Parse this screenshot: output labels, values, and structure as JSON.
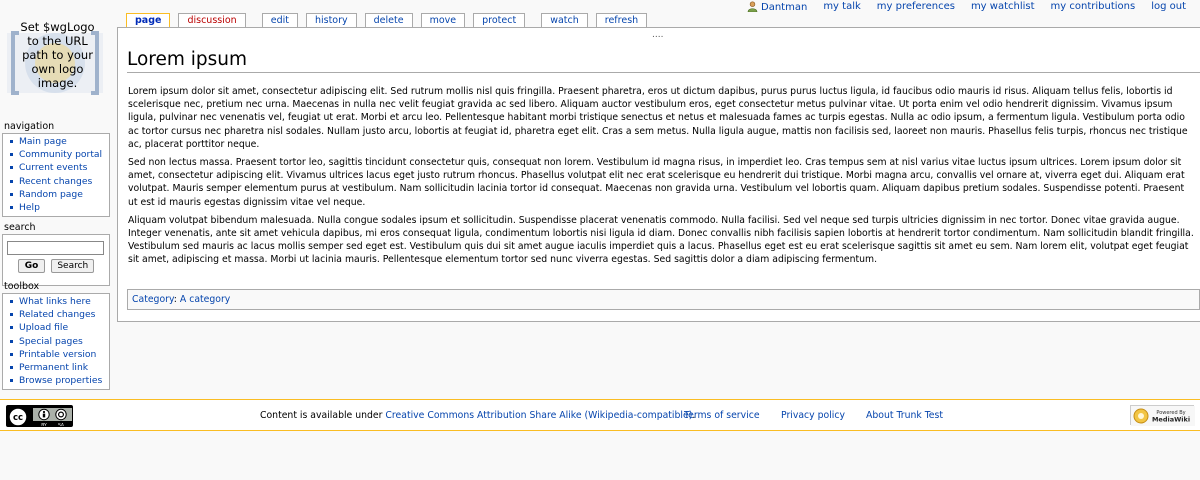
{
  "personal": {
    "username": "Dantman",
    "talk": "my talk",
    "preferences": "my preferences",
    "watchlist": "my watchlist",
    "contributions": "my contributions",
    "logout": "log out"
  },
  "logo": {
    "lines": [
      "Set $wgLogo",
      "to the URL",
      "path to your",
      "own logo",
      "image."
    ]
  },
  "tabs": {
    "page": "page",
    "discussion": "discussion",
    "edit": "edit",
    "history": "history",
    "delete": "delete",
    "move": "move",
    "protect": "protect",
    "watch": "watch",
    "refresh": "refresh"
  },
  "content": {
    "dots": "....",
    "title": "Lorem ipsum",
    "paragraphs": [
      "Lorem ipsum dolor sit amet, consectetur adipiscing elit. Sed rutrum mollis nisl quis fringilla. Praesent pharetra, eros ut dictum dapibus, purus purus luctus ligula, id faucibus odio mauris id risus. Aliquam tellus felis, lobortis id scelerisque nec, pretium nec urna. Maecenas in nulla nec velit feugiat gravida ac sed libero. Aliquam auctor vestibulum eros, eget consectetur metus pulvinar vitae. Ut porta enim vel odio hendrerit dignissim. Vivamus ipsum ligula, pulvinar nec venenatis vel, feugiat ut erat. Morbi et arcu leo. Pellentesque habitant morbi tristique senectus et netus et malesuada fames ac turpis egestas. Nulla ac odio ipsum, a fermentum ligula. Vestibulum porta odio ac tortor cursus nec pharetra nisl sodales. Nullam justo arcu, lobortis at feugiat id, pharetra eget elit. Cras a sem metus. Nulla ligula augue, mattis non facilisis sed, laoreet non mauris. Phasellus felis turpis, rhoncus nec tristique ac, placerat porttitor neque.",
      "Sed non lectus massa. Praesent tortor leo, sagittis tincidunt consectetur quis, consequat non lorem. Vestibulum id magna risus, in imperdiet leo. Cras tempus sem at nisl varius vitae luctus ipsum ultrices. Lorem ipsum dolor sit amet, consectetur adipiscing elit. Vivamus ultrices lacus eget justo rutrum rhoncus. Phasellus volutpat elit nec erat scelerisque eu hendrerit dui tristique. Morbi magna arcu, convallis vel ornare at, viverra eget dui. Aliquam erat volutpat. Mauris semper elementum purus at vestibulum. Nam sollicitudin lacinia tortor id consequat. Maecenas non gravida urna. Vestibulum vel lobortis quam. Aliquam dapibus pretium sodales. Suspendisse potenti. Praesent ut est id mauris egestas dignissim vitae vel neque.",
      "Aliquam volutpat bibendum malesuada. Nulla congue sodales ipsum et sollicitudin. Suspendisse placerat venenatis commodo. Nulla facilisi. Sed vel neque sed turpis ultricies dignissim in nec tortor. Donec vitae gravida augue. Integer venenatis, ante sit amet vehicula dapibus, mi eros consequat ligula, condimentum lobortis nisi ligula id diam. Donec convallis nibh facilisis sapien lobortis at hendrerit tortor condimentum. Nam sollicitudin blandit fringilla. Vestibulum sed mauris ac lacus mollis semper sed eget est. Vestibulum quis dui sit amet augue iaculis imperdiet quis a lacus. Phasellus eget est eu erat scelerisque sagittis sit amet eu sem. Nam lorem elit, volutpat eget feugiat sit amet, adipiscing et massa. Morbi ut lacinia mauris. Pellentesque elementum tortor sed nunc viverra egestas. Sed sagittis dolor a diam adipiscing fermentum."
    ],
    "category_prefix": "Category",
    "category_sep": ": ",
    "category": "A category"
  },
  "navigation": {
    "heading": "navigation",
    "items": [
      "Main page",
      "Community portal",
      "Current events",
      "Recent changes",
      "Random page",
      "Help"
    ]
  },
  "search": {
    "heading": "search",
    "input_value": "",
    "go_label": "Go",
    "search_label": "Search"
  },
  "toolbox": {
    "heading": "toolbox",
    "items": [
      "What links here",
      "Related changes",
      "Upload file",
      "Special pages",
      "Printable version",
      "Permanent link",
      "Browse properties"
    ]
  },
  "footer": {
    "license_prefix": "Content is available under ",
    "license_link": "Creative Commons Attribution Share Alike (Wikipedia-compatible)",
    "license_suffix": ".",
    "terms": "Terms of service",
    "privacy": "Privacy policy",
    "about": "About Trunk Test",
    "cc_by": "BY",
    "cc_sa": "SA",
    "mw_line1": "Powered By",
    "mw_line2": "MediaWiki"
  },
  "colors": {
    "link": "#0645ad",
    "new_link": "#ba0000",
    "selected_tab_border": "#fabd23",
    "footer_border": "#fabd23"
  }
}
